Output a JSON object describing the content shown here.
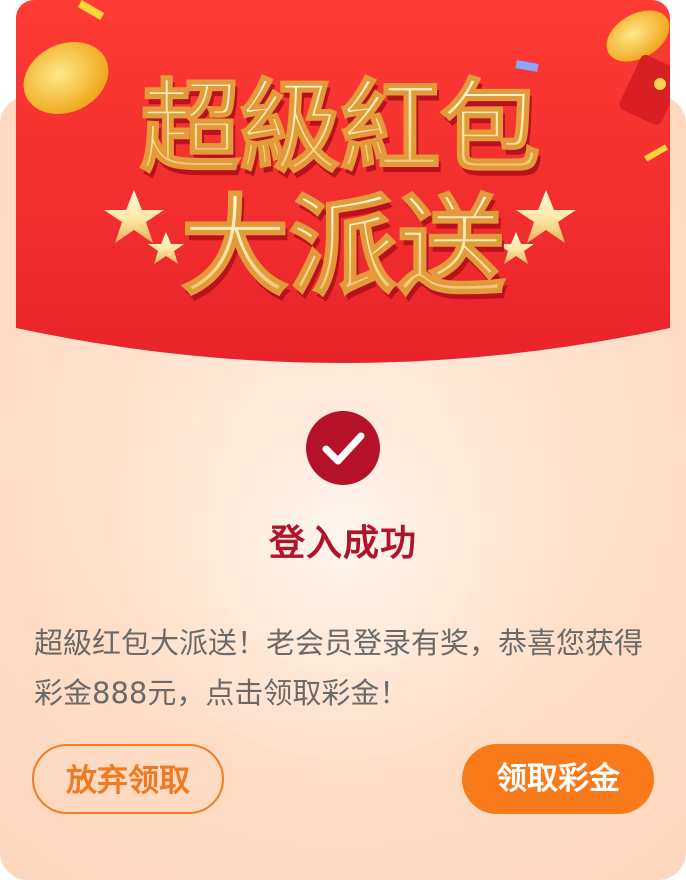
{
  "banner": {
    "headline_line1": "超級紅包",
    "headline_line2": "大派送"
  },
  "status": {
    "icon": "checkmark-icon",
    "title": "登入成功"
  },
  "message": {
    "text": "超級红包大派送！老会员登录有奖，恭喜您获得彩金888元，点击领取彩金！"
  },
  "actions": {
    "abandon_label": "放弃领取",
    "claim_label": "领取彩金"
  },
  "colors": {
    "banner_red": "#f0302e",
    "accent_orange": "#f97a1a",
    "title_red": "#b0142a",
    "card_bg": "#ffdcc4"
  }
}
